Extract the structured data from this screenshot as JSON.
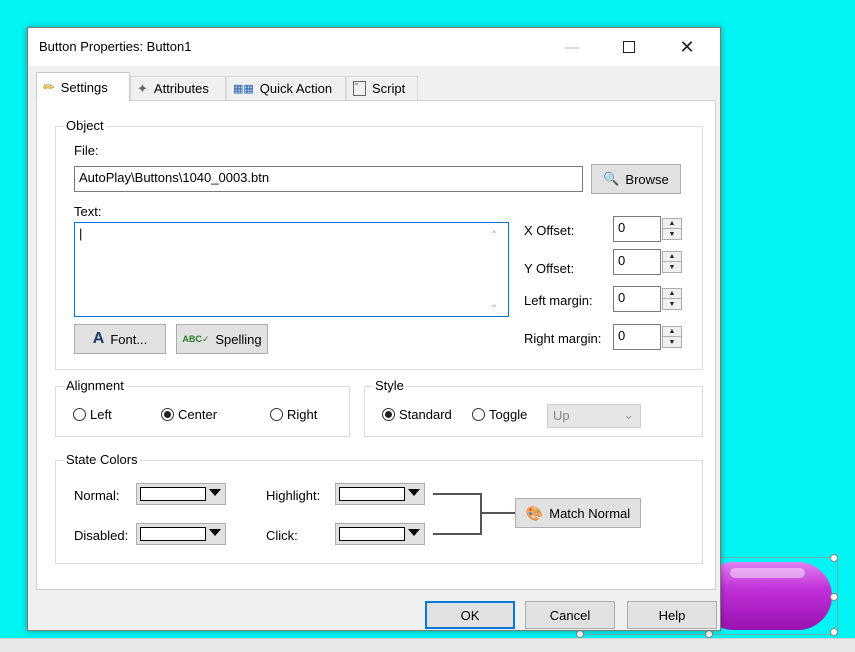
{
  "window": {
    "title": "Button Properties: Button1"
  },
  "tabs": [
    {
      "label": "Settings",
      "icon": "pencil-icon"
    },
    {
      "label": "Attributes",
      "icon": "wand-icon"
    },
    {
      "label": "Quick Action",
      "icon": "flow-icon"
    },
    {
      "label": "Script",
      "icon": "script-icon"
    }
  ],
  "object": {
    "group_label": "Object",
    "file_label": "File:",
    "file_value": "AutoPlay\\Buttons\\1040_0003.btn",
    "browse_label": "Browse",
    "text_label": "Text:",
    "text_value": "|",
    "x_offset_label": "X Offset:",
    "x_offset_value": "0",
    "y_offset_label": "Y Offset:",
    "y_offset_value": "0",
    "left_margin_label": "Left margin:",
    "left_margin_value": "0",
    "right_margin_label": "Right margin:",
    "right_margin_value": "0",
    "font_label": "Font...",
    "spelling_label": "Spelling"
  },
  "alignment": {
    "group_label": "Alignment",
    "options": [
      "Left",
      "Center",
      "Right"
    ],
    "selected": "Center"
  },
  "style": {
    "group_label": "Style",
    "options": [
      "Standard",
      "Toggle"
    ],
    "selected": "Standard",
    "toggle_state": "Up"
  },
  "state_colors": {
    "group_label": "State Colors",
    "normal_label": "Normal:",
    "disabled_label": "Disabled:",
    "highlight_label": "Highlight:",
    "click_label": "Click:",
    "match_label": "Match Normal"
  },
  "footer": {
    "ok": "OK",
    "cancel": "Cancel",
    "help": "Help"
  },
  "colors": {
    "background": "#00f4f4",
    "canvas_button": "#b020c8",
    "focus": "#0078d7"
  }
}
